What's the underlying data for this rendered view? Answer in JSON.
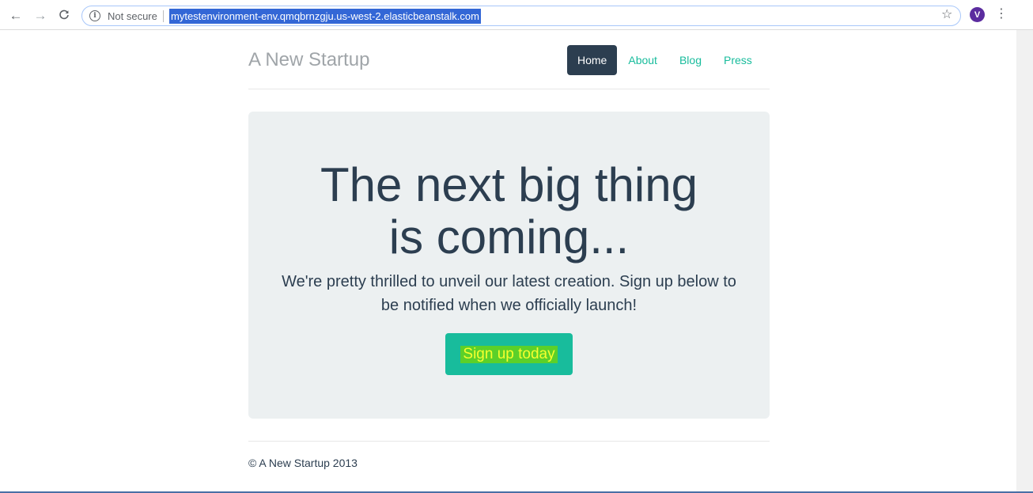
{
  "browser": {
    "security_label": "Not secure",
    "url": "mytestenvironment-env.qmqbrnzgju.us-west-2.elasticbeanstalk.com",
    "profile_initial": "V",
    "icons": {
      "back": "back-arrow-icon",
      "forward": "forward-arrow-icon",
      "reload": "reload-icon",
      "info": "info-icon",
      "bookmark": "star-icon",
      "menu": "kebab-menu-icon"
    }
  },
  "site": {
    "brand": "A New Startup",
    "nav": [
      {
        "label": "Home",
        "active": true
      },
      {
        "label": "About",
        "active": false
      },
      {
        "label": "Blog",
        "active": false
      },
      {
        "label": "Press",
        "active": false
      }
    ],
    "hero": {
      "headline_line1": "The next big thing",
      "headline_line2": "is coming...",
      "lead": "We're pretty thrilled to unveil our latest creation. Sign up below to be notified when we officially launch!",
      "cta_label": "Sign up today"
    },
    "footer": "© A New Startup 2013"
  },
  "colors": {
    "accent": "#18bc9c",
    "dark": "#2c3e50",
    "jumbotron_bg": "#ecf0f1",
    "url_highlight": "#3367d6",
    "cta_text_highlight": "#5bd02a"
  }
}
